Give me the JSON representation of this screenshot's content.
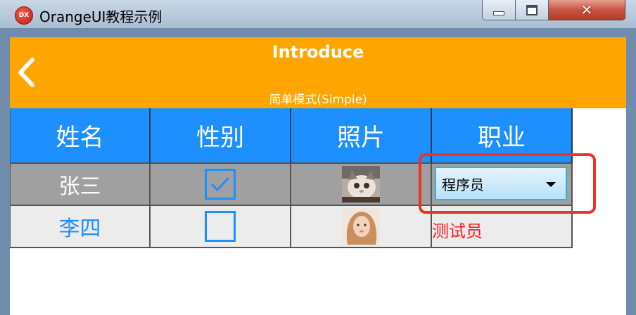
{
  "window": {
    "title": "OrangeUI教程示例",
    "icon_text": "DX",
    "minimize_icon": "minimize-icon",
    "maximize_icon": "maximize-icon",
    "close_icon": "close-icon"
  },
  "header": {
    "title": "Introduce",
    "subtitle": "简单模式(Simple)",
    "back_icon": "chevron-left-icon",
    "color": "#ffa500"
  },
  "table": {
    "columns": [
      "姓名",
      "性别",
      "照片",
      "职业"
    ],
    "header_color": "#1e8fff",
    "rows": [
      {
        "name": "张三",
        "gender_checked": true,
        "photo": "cat-photo",
        "job": "程序员",
        "job_display": "dropdown"
      },
      {
        "name": "李四",
        "gender_checked": false,
        "photo": "portrait-photo",
        "job": "测试员",
        "job_display": "text"
      }
    ]
  }
}
